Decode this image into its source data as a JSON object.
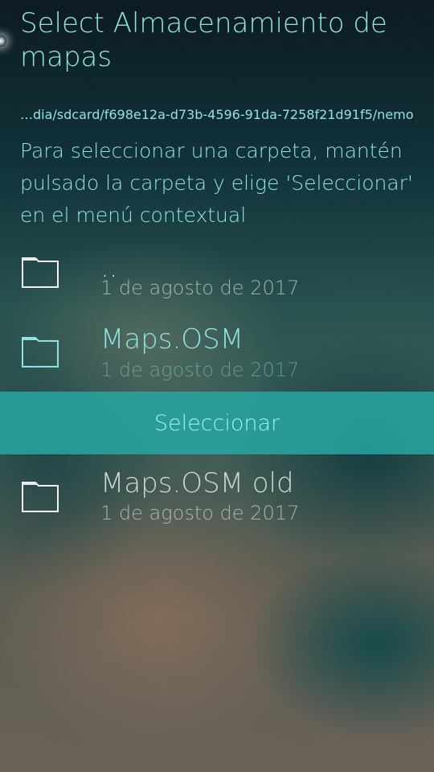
{
  "header": {
    "title": "Select Almacenamiento de mapas",
    "path": "…dia/sdcard/f698e12a-d73b-4596-91da-7258f21d91f5/nemo",
    "hint": "Para seleccionar una carpeta, mantén pulsado la carpeta y elige 'Seleccionar' en el menú contextual"
  },
  "folders": [
    {
      "name": "..",
      "date": "1 de agosto de 2017",
      "icon": "folder-icon"
    },
    {
      "name": "Maps.OSM",
      "date": "1 de agosto de 2017",
      "icon": "folder-icon"
    },
    {
      "name": "Maps.OSM old",
      "date": "1 de agosto de 2017",
      "icon": "folder-icon"
    }
  ],
  "context_menu": {
    "item_label": "Seleccionar"
  },
  "colors": {
    "accent": "#8fe3e2",
    "menu_background": "#28aaa5"
  }
}
